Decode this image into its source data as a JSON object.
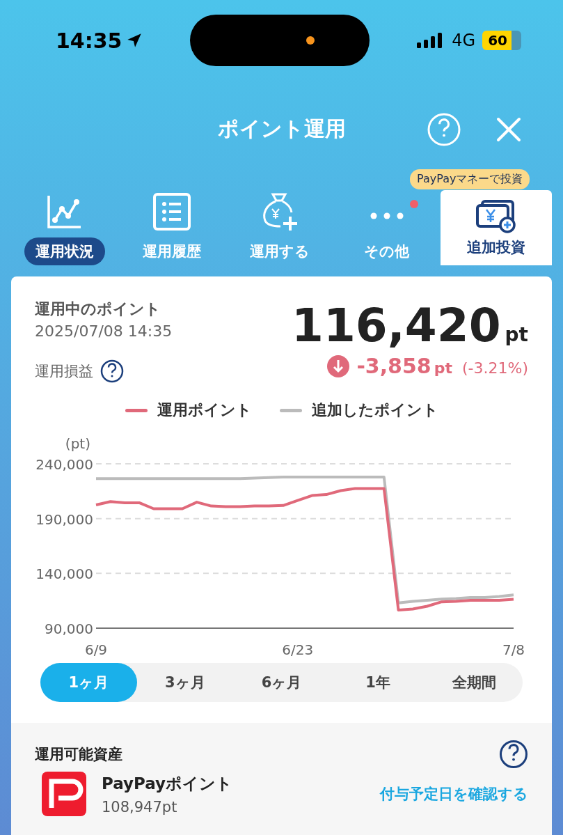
{
  "status_bar": {
    "time": "14:35",
    "network": "4G",
    "battery": "60"
  },
  "header": {
    "title": "ポイント運用"
  },
  "nav_items": [
    {
      "kind": "chart",
      "label": "運用状況",
      "selected": true,
      "notification": false
    },
    {
      "kind": "list",
      "label": "運用履歴",
      "selected": false,
      "notification": false
    },
    {
      "kind": "bag",
      "label": "運用する",
      "selected": false,
      "notification": false
    },
    {
      "kind": "more",
      "label": "その他",
      "selected": false,
      "notification": true
    },
    {
      "kind": "invest",
      "label": "追加投資",
      "selected": false,
      "notification": false,
      "tooltip": "PayPayマネーで投資"
    }
  ],
  "summary": {
    "label": "運用中のポイント",
    "timestamp": "2025/07/08 14:35",
    "value": "116,420",
    "unit": "pt",
    "pl_label": "運用損益",
    "change": "-3,858",
    "change_unit": "pt",
    "change_pct": "(-3.21%)"
  },
  "chart_data": {
    "type": "line",
    "ylabel": "(pt)",
    "categories": [
      "6/9",
      null,
      null,
      null,
      null,
      null,
      null,
      null,
      null,
      null,
      null,
      null,
      null,
      null,
      "6/23",
      null,
      null,
      null,
      null,
      null,
      null,
      null,
      null,
      null,
      null,
      null,
      null,
      null,
      null,
      "7/8"
    ],
    "series": [
      {
        "name": "運用ポイント",
        "color": "#e0697a",
        "values": [
          202500,
          205500,
          204500,
          204500,
          199000,
          199000,
          199000,
          205000,
          201500,
          201000,
          201000,
          201500,
          201500,
          202000,
          206500,
          211000,
          212000,
          215500,
          217500,
          217500,
          217500,
          106500,
          107500,
          110000,
          114000,
          114500,
          115500,
          115500,
          115500,
          116400
        ]
      },
      {
        "name": "追加したポイント",
        "color": "#bbbbbb",
        "values": [
          226500,
          226500,
          226500,
          226500,
          226500,
          226500,
          226500,
          226500,
          226500,
          226500,
          226500,
          227000,
          227500,
          228000,
          228000,
          228000,
          228000,
          228000,
          228000,
          228000,
          228000,
          113000,
          114500,
          115500,
          116500,
          117000,
          118000,
          118000,
          119000,
          120300
        ]
      }
    ],
    "ylim": [
      90000,
      240000
    ],
    "yticks": [
      {
        "value": 90000,
        "label": "90,000"
      },
      {
        "value": 140000,
        "label": "140,000"
      },
      {
        "value": 190000,
        "label": "190,000"
      },
      {
        "value": 240000,
        "label": "240,000"
      }
    ]
  },
  "periods": [
    {
      "label": "1ヶ月",
      "selected": true
    },
    {
      "label": "3ヶ月",
      "selected": false
    },
    {
      "label": "6ヶ月",
      "selected": false
    },
    {
      "label": "1年",
      "selected": false
    },
    {
      "label": "全期間",
      "selected": false
    }
  ],
  "assets": {
    "title": "運用可能資産",
    "name": "PayPayポイント",
    "amount": "108,947pt",
    "link": "付与予定日を確認する"
  }
}
